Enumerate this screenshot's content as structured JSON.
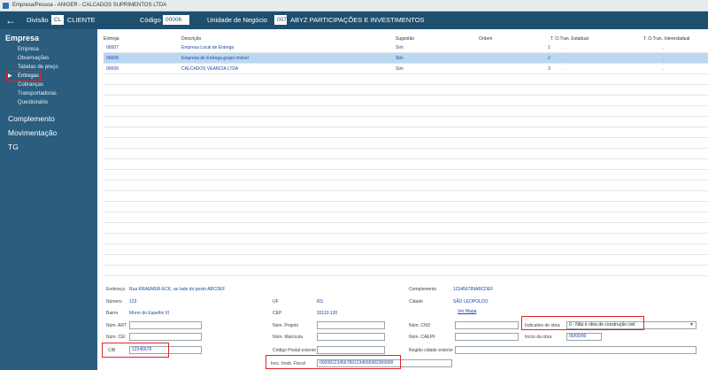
{
  "window": {
    "title": "Empresa/Pessoa - ANIGER - CALCADOS SUPRIMENTOS LTDA"
  },
  "header": {
    "back_icon": "arrow-left-icon",
    "divisao_label": "Divisão",
    "divisao_code": "CL",
    "divisao_name": "CLIENTE",
    "codigo_label": "Código",
    "codigo_value": "00006",
    "unidade_label": "Unidade de Negócio",
    "unidade_code": "007",
    "unidade_name": "ABYZ PARTICIPAÇÕES E INVESTIMENTOS"
  },
  "sidebar": {
    "title": "Empresa",
    "items": [
      "Empresa",
      "Observações",
      "Tabelas de preço",
      "Entregas",
      "Cobranças",
      "Transportadoras",
      "Questionário"
    ],
    "active_item": "Entregas",
    "sections": [
      "Complemento",
      "Movimentação",
      "TG"
    ]
  },
  "grid": {
    "columns": [
      "Entrega",
      "Descrição",
      "Sugestão",
      "Ordem",
      "T. O.Tran. Estadual",
      "T. O.Tran. Interestadual"
    ],
    "rows": [
      {
        "entrega": "00007",
        "descricao": "Empresa Local de Entrega",
        "sugestao": "Sim",
        "ordem": "1",
        "estadual": ".",
        "interestadual": "."
      },
      {
        "entrega": "00008",
        "descricao": "Empresa de Entrega grupo imóvel",
        "sugestao": "Sim",
        "ordem": "2",
        "estadual": ".",
        "interestadual": "."
      },
      {
        "entrega": "00009",
        "descricao": "CALCADOS VEANCIA LTDA",
        "sugestao": "Sim",
        "ordem": "3",
        "estadual": ".",
        "interestadual": "."
      }
    ]
  },
  "form": {
    "endereco_label": "Endereço",
    "endereco_value": "Rua KRAEMER-ECK, ao lado do posto ABCDEF",
    "complemento_label": "Complemento",
    "complemento_value": "123456789ABCDEF",
    "numero_label": "Número",
    "numero_value": "123",
    "uf_label": "UF",
    "uf_value": "RS",
    "cidade_label": "Cidade",
    "cidade_value": "SÃO LEOPOLDO",
    "bairro_label": "Bairro",
    "bairro_value": "Morro do Espelho III",
    "cep_label": "CEP",
    "cep_value": "93110.120",
    "ver_mapa": "Ver Mapa",
    "num_art_label": "Núm. ART",
    "num_projeto_label": "Núm. Projeto",
    "num_cno_label": "Núm. CNO",
    "indicativo_label": "Indicativo de obra",
    "indicativo_value": "0 - Não é obra de construção civil",
    "num_cei_label": "Núm. CEI",
    "num_matricula_label": "Núm. Matrícula",
    "num_caepf_label": "Núm. CAEPF",
    "inicio_obra_label": "Início da obra",
    "inicio_obra_value": "00/00/00",
    "cib_label": "CIB",
    "cib_value": "12345678",
    "cod_postal_label": "Código Postal exterior",
    "regiao_label": "Região cidade exterior",
    "insc_label": "Insc. Imob. Fiscal",
    "insc_value": "000081234567891234566982369999"
  },
  "colors": {
    "header": "#1f4f6e",
    "sidebar": "#2a5d7e",
    "selected_row": "#bcd7f0",
    "highlight": "#e0222a"
  }
}
